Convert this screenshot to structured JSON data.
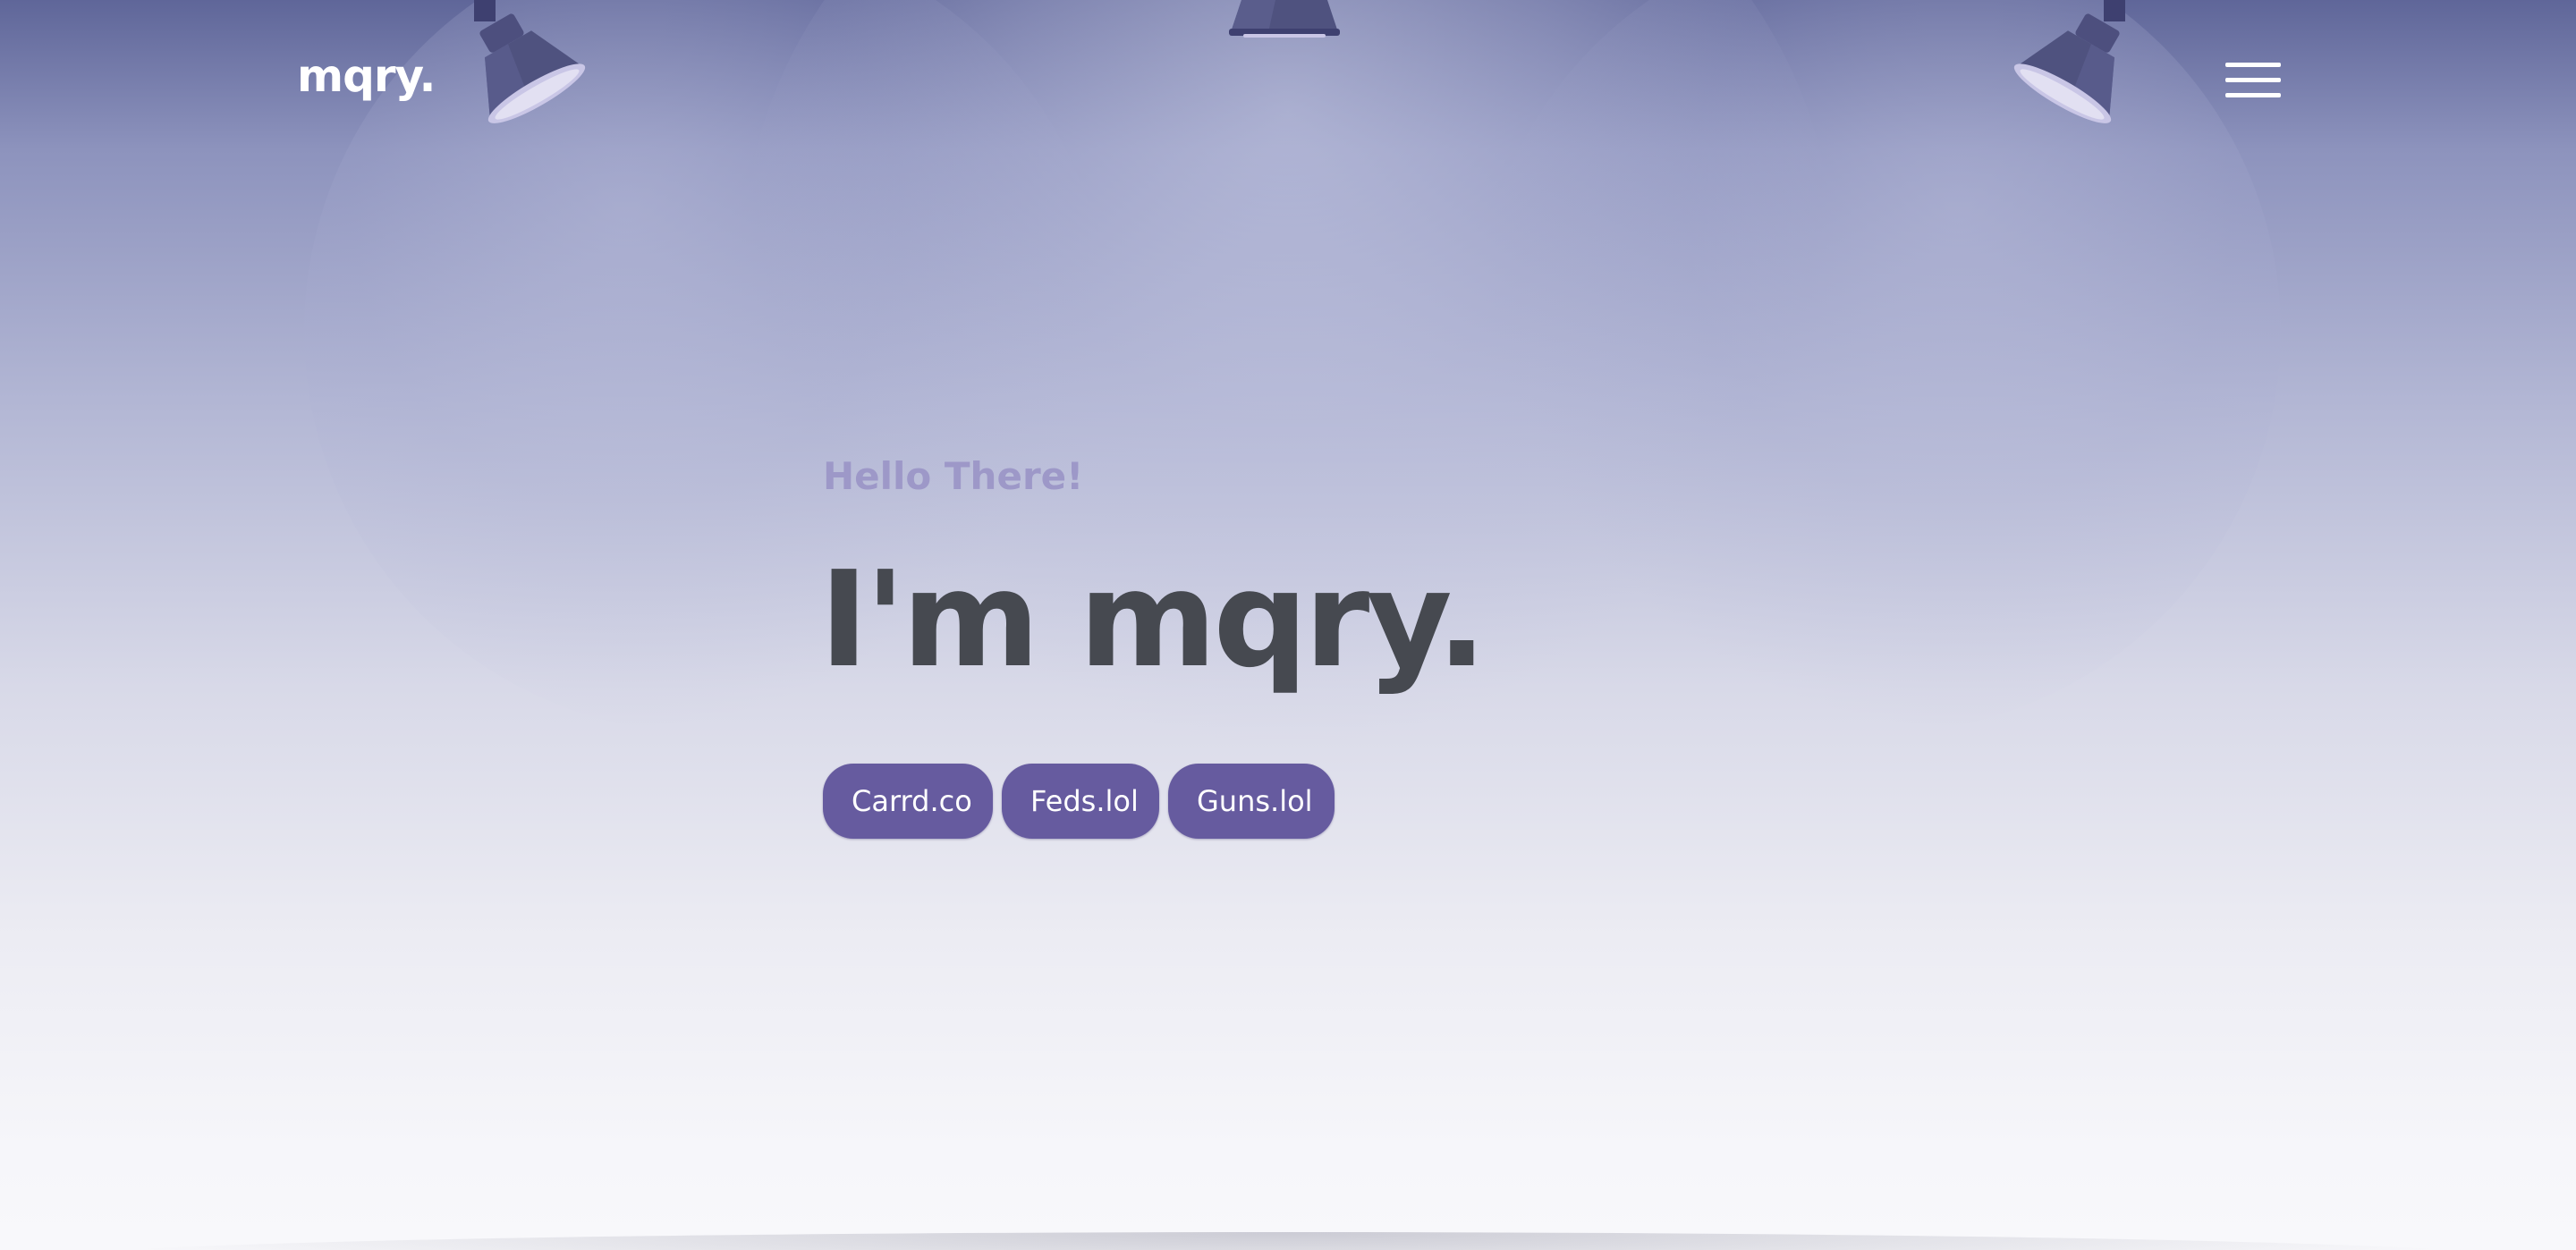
{
  "header": {
    "logo_text": "mqry.",
    "menu_icon": "hamburger-menu-icon"
  },
  "hero": {
    "greeting": "Hello There!",
    "headline": "I'm mqry."
  },
  "links": [
    {
      "label": "Carrd.co"
    },
    {
      "label": "Feds.lol"
    },
    {
      "label": "Guns.lol"
    }
  ],
  "decor": {
    "lamp_icons": [
      "spotlight-left-icon",
      "spotlight-center-icon",
      "spotlight-right-icon"
    ]
  },
  "colors": {
    "background_top": "#5f6699",
    "background_bottom": "#f8f8fb",
    "greeting": "#9d98c8",
    "headline": "#464950",
    "pill": "#665b9f",
    "white": "#ffffff"
  }
}
